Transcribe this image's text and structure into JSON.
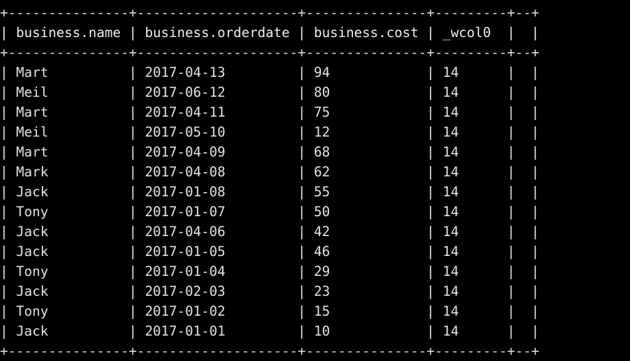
{
  "terminal": {
    "background_color": "#000000",
    "text_color": "#e8e8e8",
    "border_color": "#dcdcdc"
  },
  "table": {
    "columns": [
      {
        "header": "business.name",
        "width": 15,
        "align": "left"
      },
      {
        "header": "business.orderdate",
        "width": 20,
        "align": "left"
      },
      {
        "header": "business.cost",
        "width": 15,
        "align": "left"
      },
      {
        "header": "_wcol0",
        "width": 9,
        "align": "left"
      },
      {
        "header": "",
        "width": 2,
        "align": "left"
      }
    ],
    "row_count": 14,
    "rows": [
      {
        "name": "Mart",
        "orderdate": "2017-04-13",
        "cost": "94",
        "wcol0": "14",
        "extra": ""
      },
      {
        "name": "Meil",
        "orderdate": "2017-06-12",
        "cost": "80",
        "wcol0": "14",
        "extra": ""
      },
      {
        "name": "Mart",
        "orderdate": "2017-04-11",
        "cost": "75",
        "wcol0": "14",
        "extra": ""
      },
      {
        "name": "Meil",
        "orderdate": "2017-05-10",
        "cost": "12",
        "wcol0": "14",
        "extra": ""
      },
      {
        "name": "Mart",
        "orderdate": "2017-04-09",
        "cost": "68",
        "wcol0": "14",
        "extra": ""
      },
      {
        "name": "Mark",
        "orderdate": "2017-04-08",
        "cost": "62",
        "wcol0": "14",
        "extra": ""
      },
      {
        "name": "Jack",
        "orderdate": "2017-01-08",
        "cost": "55",
        "wcol0": "14",
        "extra": ""
      },
      {
        "name": "Tony",
        "orderdate": "2017-01-07",
        "cost": "50",
        "wcol0": "14",
        "extra": ""
      },
      {
        "name": "Jack",
        "orderdate": "2017-04-06",
        "cost": "42",
        "wcol0": "14",
        "extra": ""
      },
      {
        "name": "Jack",
        "orderdate": "2017-01-05",
        "cost": "46",
        "wcol0": "14",
        "extra": ""
      },
      {
        "name": "Tony",
        "orderdate": "2017-01-04",
        "cost": "29",
        "wcol0": "14",
        "extra": ""
      },
      {
        "name": "Jack",
        "orderdate": "2017-02-03",
        "cost": "23",
        "wcol0": "14",
        "extra": ""
      },
      {
        "name": "Tony",
        "orderdate": "2017-01-02",
        "cost": "15",
        "wcol0": "14",
        "extra": ""
      },
      {
        "name": "Jack",
        "orderdate": "2017-01-01",
        "cost": "10",
        "wcol0": "14",
        "extra": ""
      }
    ]
  },
  "rendered_lines": {
    "top_rule": "+---------------+--------------------+---------------+---------+--+",
    "header_row": "| business.name | business.orderdate | business.cost | _wcol0  |  |",
    "header_rule": "+---------------+--------------------+---------------+---------+--+",
    "bottom_rule": "+---------------+--------------------+---------------+---------+--+"
  }
}
